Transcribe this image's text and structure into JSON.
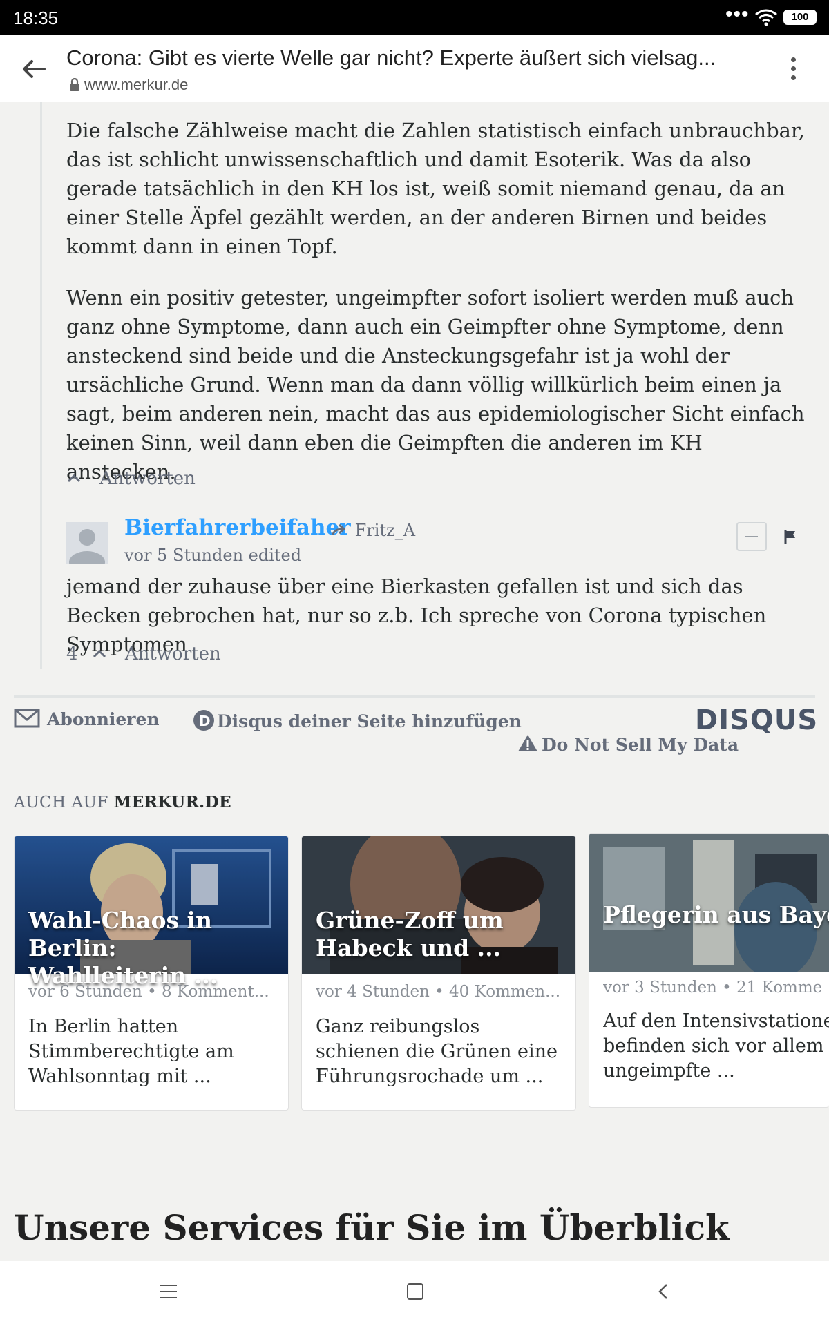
{
  "status_bar": {
    "time": "18:35",
    "more": "•••",
    "battery": "100"
  },
  "browser": {
    "title": "Corona: Gibt es vierte Welle gar nicht? Experte äußert sich vielsag...",
    "url": "www.merkur.de"
  },
  "comments": {
    "paragraph1": "Die falsche Zählweise macht die Zahlen statistisch einfach unbrauchbar, das ist schlicht unwissenschaftlich und damit Esoterik. Was da also gerade tatsächlich in den KH los ist, weiß somit niemand genau, da an einer Stelle Äpfel gezählt werden, an der anderen Birnen und beides kommt dann in einen Topf.",
    "paragraph2": "Wenn ein positiv getester, ungeimpfter sofort isoliert werden muß auch ganz ohne Symptome, dann auch ein Geimpfter ohne Symptome, denn ansteckend sind beide und die Ansteckungsgefahr ist ja wohl der ursächliche Grund. Wenn man da dann völlig willkürlich beim einen ja sagt, beim anderen nein, macht das aus epidemiologischer Sicht einfach keinen Sinn, weil dann eben die Geimpften die anderen im KH anstecken.",
    "reply_label_1": "Antworten",
    "author": "Bierfahrerbeifaher",
    "reply_to": "Fritz_A",
    "time": "vor 5 Stunden edited",
    "reply_text": "jemand der zuhause über eine Bierkasten gefallen ist und sich das Becken gebrochen hat, nur so z.b. Ich spreche von Corona typischen Symptomen",
    "votes": "4",
    "reply_label_2": "Antworten"
  },
  "disqus_footer": {
    "subscribe": "Abonnieren",
    "add_disqus": "Disqus deiner Seite hinzufügen",
    "do_not_sell": "Do Not Sell My Data",
    "logo": "DISQUS"
  },
  "also_on": {
    "prefix": "AUCH AUF ",
    "site": "MERKUR.DE"
  },
  "cards": [
    {
      "headline": "Wahl-Chaos in Berlin:\nWahlleiterin ...",
      "meta": "vor 6 Stunden • 8 Komment...",
      "excerpt": "In Berlin hatten\nStimmberechtigte am\nWahlsonntag mit ..."
    },
    {
      "headline": "Grüne-Zoff um\nHabeck und ...",
      "meta": "vor 4 Stunden • 40 Kommen...",
      "excerpt": "Ganz reibungslos\nschienen die Grünen eine\nFührungsrochade um ..."
    },
    {
      "headline": "Pflegerin aus Bayern\nregt sich über ...",
      "meta": "vor 3 Stunden • 21 Komme",
      "excerpt": "Auf den Intensivstationen\nbefinden sich vor allem\nungeimpfte ..."
    }
  ],
  "services_title": "Unsere Services für Sie im Überblick"
}
